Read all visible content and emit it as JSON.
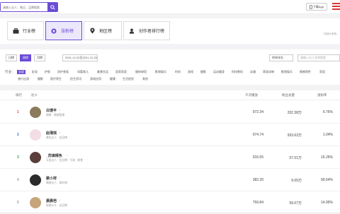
{
  "topbar": {
    "search_placeholder": "请输入达人、笔记、品牌搜索",
    "download_label": "下载App"
  },
  "rank_tabs": [
    {
      "label": "行业榜",
      "icon": "briefcase-icon"
    },
    {
      "label": "涨粉榜",
      "icon": "up-arrow-icon"
    },
    {
      "label": "地区榜",
      "icon": "location-icon"
    },
    {
      "label": "创作者排行榜",
      "icon": "creator-icon"
    }
  ],
  "hint": "* 仅统计有效...",
  "filters": {
    "periods": [
      "日榜",
      "周榜",
      "月榜"
    ],
    "date_range": "2021-12-20至2021-12-26",
    "sort": "榜单排名",
    "search_placeholder": "请输入达人名称搜索",
    "industry_label": "行业：",
    "industries_row1": [
      "全部",
      "彩妆",
      "护肤",
      "洗护香氛",
      "母婴育儿",
      "美食饮品",
      "居家家居",
      "服饰穿搭",
      "影视娱乐",
      "时尚",
      "游戏",
      "摄影",
      "运动健身",
      "科技数码",
      "动漫",
      "萌宠动物",
      "影视娱乐",
      "情感两性",
      "家居"
    ],
    "industries_row2": [
      "旅行出游",
      "摄影",
      "医疗养生",
      "民生资讯",
      "游戏应用",
      "健康",
      "生活经验",
      "其他"
    ]
  },
  "table": {
    "headers": [
      "排行",
      "达人",
      "千次播放",
      "粉丝总量",
      "涨粉率"
    ],
    "rows": [
      {
        "rank": "1",
        "name": "白馒平",
        "tag": "情感 · 情感管理",
        "plays": "972.34",
        "fans": "202.38万",
        "rate": "6.76%",
        "rank_color": "#e8433b",
        "avatar_color": "#8a7a5e"
      },
      {
        "rank": "2",
        "name": "赵瑾琪",
        "tag": "美妆达人 · 金冠博",
        "plays": "974.74",
        "fans": "933.63万",
        "rate": "1.04%",
        "rank_color": "#3a6fd8",
        "avatar_color": "#f3dde6"
      },
      {
        "rank": "3",
        "name": "_苏璃晴色",
        "tag": "头部达人 · 金冠博 · 引流 · 美食",
        "plays": "916.55",
        "fans": "57.51万",
        "rate": "16.26%",
        "rank_color": "#2ca34e",
        "avatar_color": "#5a3e3a"
      },
      {
        "rank": "4",
        "name": "歌小祥",
        "tag": "情感达人 · 高阶博",
        "plays": "382.20",
        "fans": "9.05万",
        "rate": "99.64%",
        "rank_color": "#999999",
        "avatar_color": "#2b2b2b"
      },
      {
        "rank": "5",
        "name": "晨晨芭",
        "tag": "智能KOL · 金冠博",
        "plays": "759.84",
        "fans": "59.07万",
        "rate": "14.95%",
        "rank_color": "#999999",
        "avatar_color": "#c7a57a"
      }
    ]
  }
}
